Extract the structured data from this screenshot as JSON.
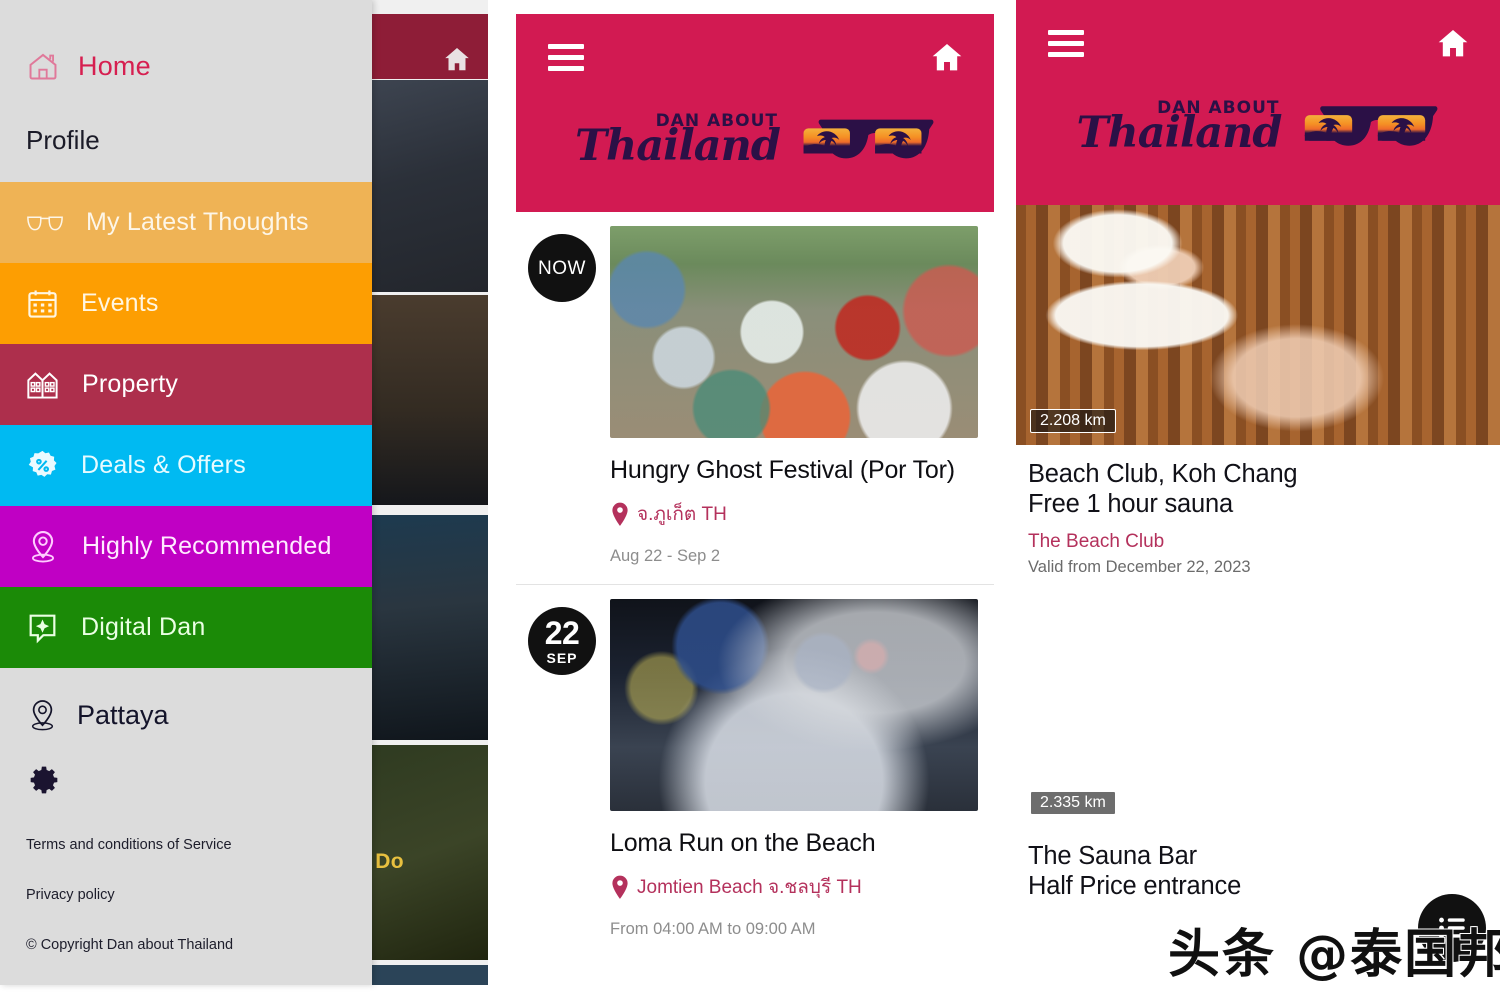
{
  "brand": {
    "name_top": "DAN ABOUT",
    "name_main": "Thailand",
    "header_color": "#d21a52",
    "logo_color": "#2b1046"
  },
  "drawer": {
    "home": {
      "label": "Home",
      "icon": "home-outline-icon",
      "color": "#d61f50"
    },
    "profile": {
      "label": "Profile"
    },
    "nav_items": [
      {
        "label": "My Latest Thoughts",
        "icon": "glasses-icon",
        "color": "#efb355"
      },
      {
        "label": "Events",
        "icon": "calendar-icon",
        "color": "#fd9e02"
      },
      {
        "label": "Property",
        "icon": "buildings-icon",
        "color": "#ad2f4c"
      },
      {
        "label": "Deals & Offers",
        "icon": "percent-badge-icon",
        "color": "#00baf2"
      },
      {
        "label": "Highly Recommended",
        "icon": "map-pin-icon",
        "color": "#c000c4"
      },
      {
        "label": "Digital Dan",
        "icon": "sparkle-chat-icon",
        "color": "#1b8a07"
      }
    ],
    "city": {
      "label": "Pattaya",
      "icon": "map-pin-icon"
    },
    "settings_icon": "gear-icon",
    "links": [
      "Terms and conditions of Service",
      "Privacy policy"
    ],
    "copyright": "© Copyright Dan about Thailand",
    "background_page": {
      "partial_text": "o Do"
    }
  },
  "events_panel": {
    "menu_icon": "hamburger-menu-icon",
    "home_icon": "home-icon",
    "events": [
      {
        "badge_type": "now",
        "badge_now": "NOW",
        "title": "Hungry Ghost Festival (Por Tor)",
        "location": "จ.ภูเก็ต TH",
        "date": "Aug 22 - Sep 2",
        "image": "hungry-ghost-festival-photo"
      },
      {
        "badge_type": "date",
        "badge_day": "22",
        "badge_month": "SEP",
        "title": "Loma Run on the Beach",
        "location": "Jomtien Beach จ.ชลบุรี TH",
        "date": "From 04:00 AM to 09:00 AM",
        "image": "loma-run-night-photo"
      }
    ]
  },
  "deals_panel": {
    "menu_icon": "hamburger-menu-icon",
    "home_icon": "home-icon",
    "deals": [
      {
        "distance": "2.208 km",
        "title_line1": "Beach Club, Koh Chang",
        "title_line2": "Free 1 hour sauna",
        "merchant": "The Beach Club",
        "valid": "Valid from December 22, 2023",
        "image": "woman-in-sauna-photo"
      },
      {
        "distance": "2.335 km",
        "title_line1": "The Sauna Bar",
        "title_line2": "Half Price entrance",
        "merchant": "",
        "valid": "",
        "image": "sauna-room-photo"
      }
    ],
    "fab_icon": "list-view-icon"
  },
  "watermark": {
    "text": "头条 @泰国邦"
  }
}
